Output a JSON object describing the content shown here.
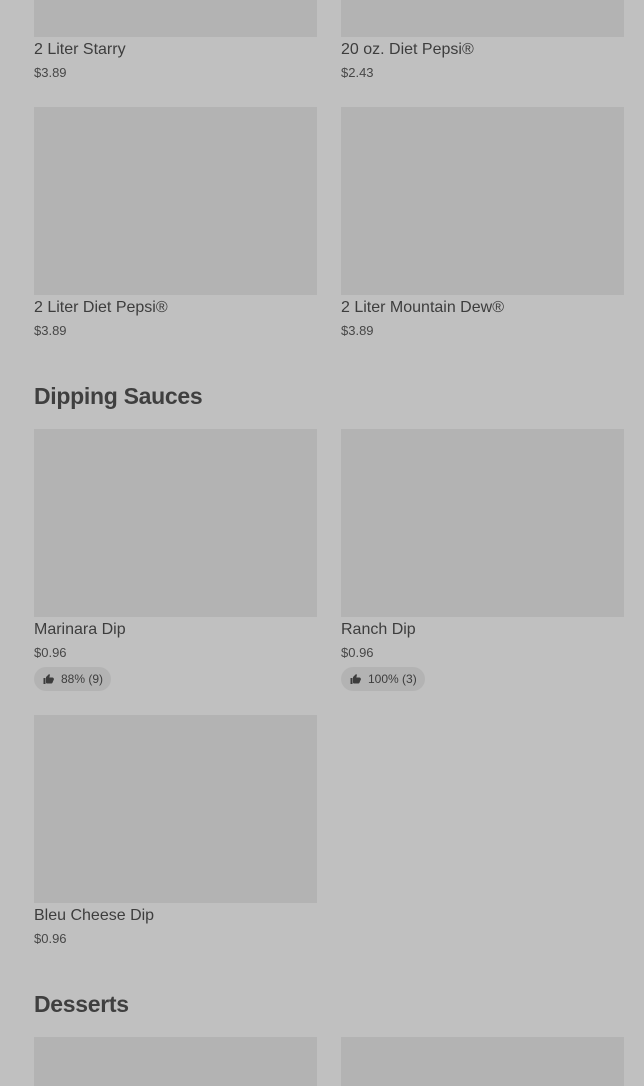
{
  "top_items": [
    {
      "name": "2 Liter Starry",
      "price": "$3.89"
    },
    {
      "name": "20 oz. Diet Pepsi®",
      "price": "$2.43"
    },
    {
      "name": "2 Liter Diet Pepsi®",
      "price": "$3.89"
    },
    {
      "name": "2 Liter Mountain Dew®",
      "price": "$3.89"
    }
  ],
  "dipping_sauces": {
    "title": "Dipping Sauces",
    "items": [
      {
        "name": "Marinara Dip",
        "price": "$0.96",
        "rating": "88% (9)"
      },
      {
        "name": "Ranch Dip",
        "price": "$0.96",
        "rating": "100% (3)"
      },
      {
        "name": "Bleu Cheese Dip",
        "price": "$0.96"
      }
    ]
  },
  "desserts": {
    "title": "Desserts"
  },
  "icons": {
    "rating": "thumbs-up-icon"
  }
}
